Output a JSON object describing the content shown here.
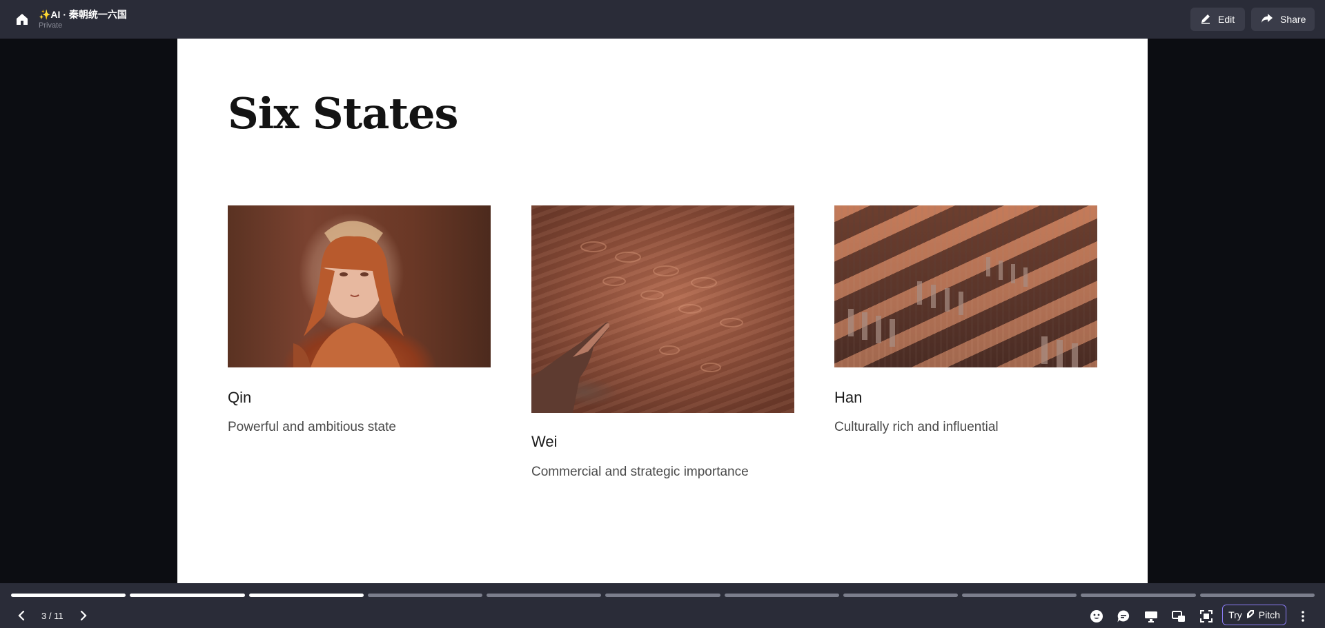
{
  "header": {
    "title": "✨AI · 秦朝统一六国",
    "visibility": "Private",
    "edit_label": "Edit",
    "share_label": "Share"
  },
  "slide": {
    "title": "Six States",
    "cards": [
      {
        "name": "Qin",
        "description": "Powerful and ambitious state",
        "image": "fresco-portrait"
      },
      {
        "name": "Wei",
        "description": "Commercial and strategic importance",
        "image": "rock-carving-hand"
      },
      {
        "name": "Han",
        "description": "Culturally rich and influential",
        "image": "terracotta-army"
      }
    ]
  },
  "footer": {
    "page_indicator": "3 / 11",
    "current_slide": 3,
    "total_slides": 11,
    "try_label": "Try",
    "pitch_label": "Pitch",
    "tools": [
      "emoji-icon",
      "comment-icon",
      "presenter-icon",
      "screens-icon",
      "fullscreen-icon",
      "more-icon"
    ]
  },
  "colors": {
    "topbar_bg": "#2a2c38",
    "canvas_bg": "#0c0d12",
    "slide_bg": "#ffffff",
    "progress_done": "#ffffff",
    "progress_todo": "#7b7e8c",
    "pitch_border": "#8b7cf6"
  }
}
